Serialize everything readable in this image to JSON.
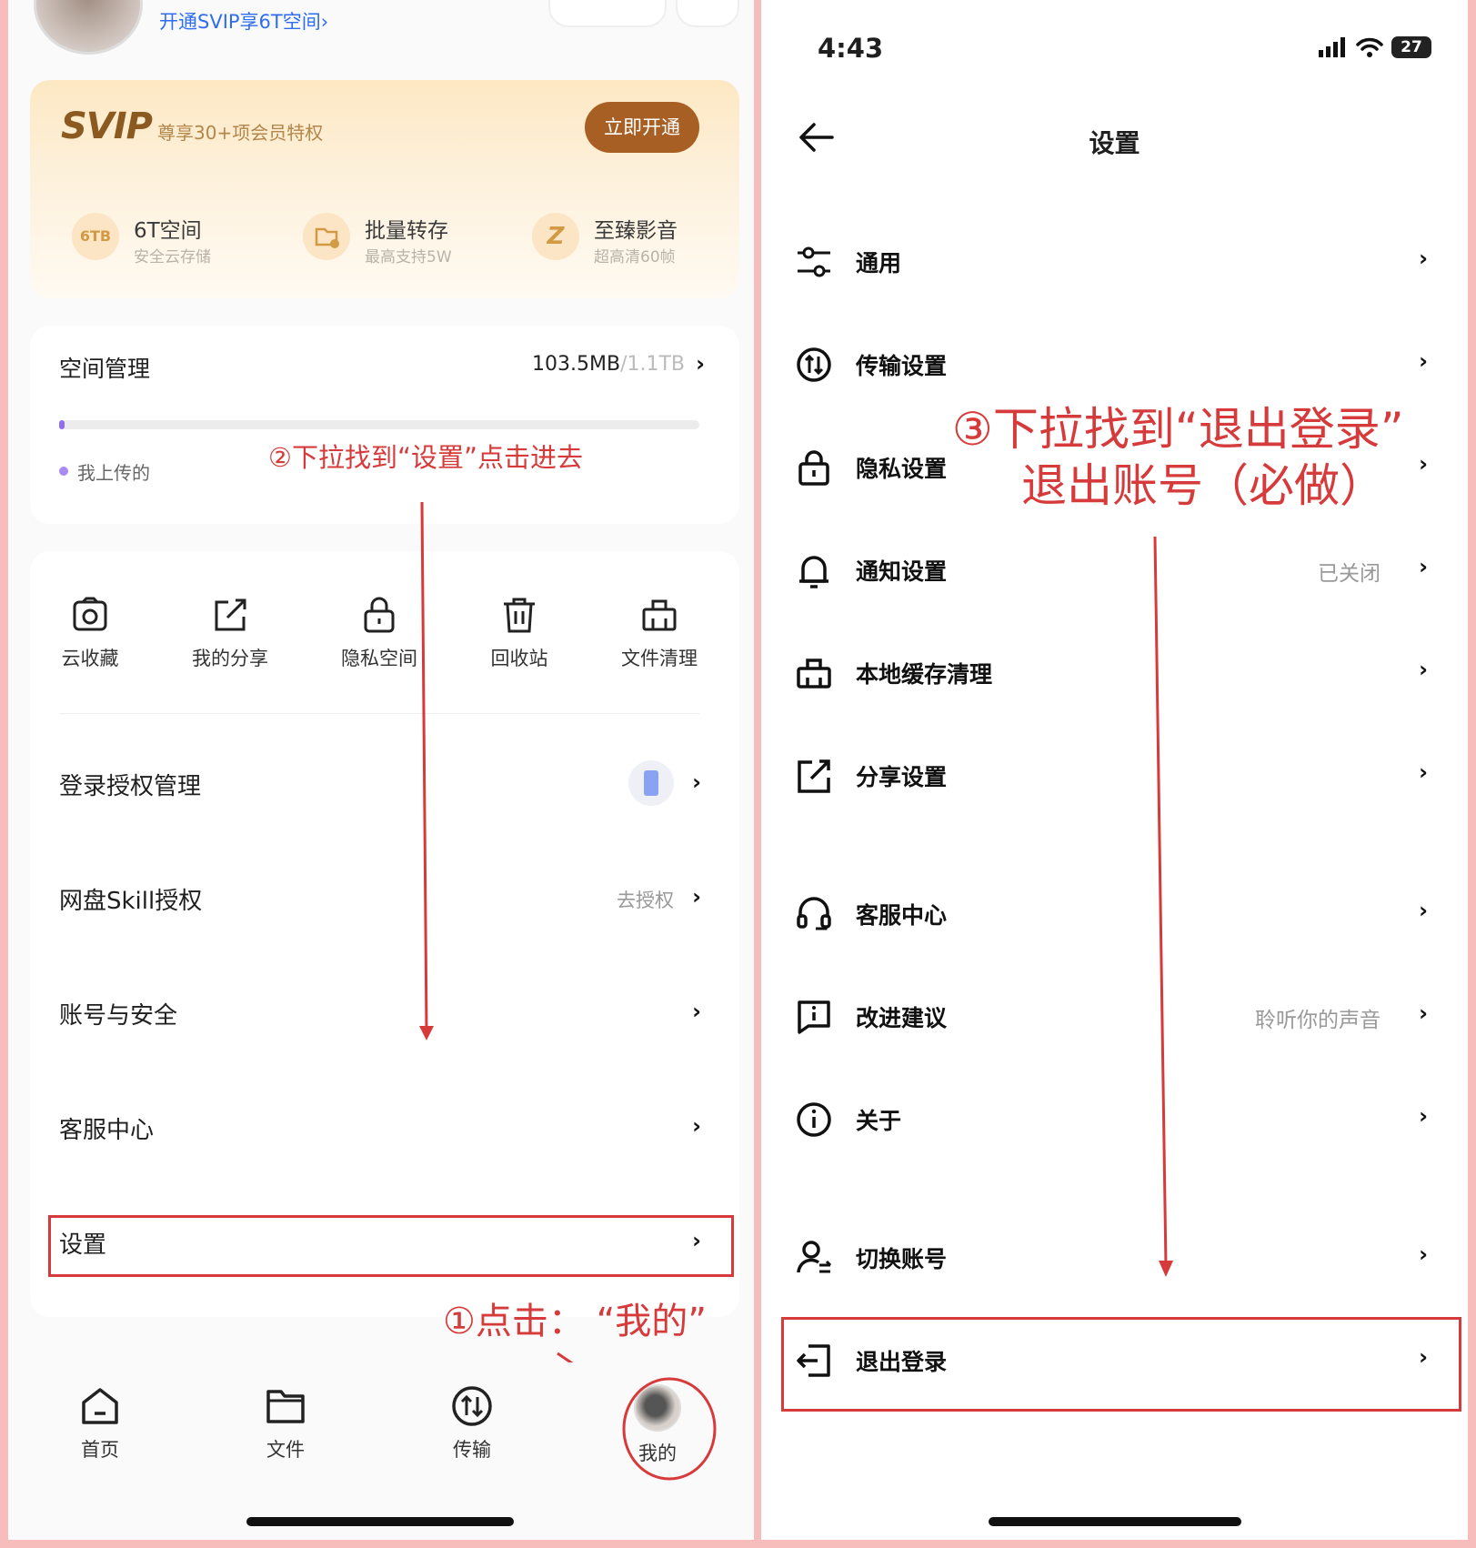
{
  "left": {
    "header_link": "开通SVIP享6T空间›",
    "svip": {
      "logo": "SVIP",
      "subtitle": "尊享30+项会员特权",
      "open_button": "立即开通",
      "perks": [
        {
          "icon_text": "6TB",
          "title": "6T空间",
          "subtitle": "安全云存储"
        },
        {
          "icon_text": "",
          "title": "批量转存",
          "subtitle": "最高支持5W"
        },
        {
          "icon_text": "Z",
          "title": "至臻影音",
          "subtitle": "超高清60帧"
        }
      ]
    },
    "space": {
      "title": "空间管理",
      "used": "103.5MB",
      "total": "/1.1TB",
      "chevron": "›",
      "progress_fraction": 0.009,
      "legend": "我上传的"
    },
    "annotation_2": "②下拉找到“设置”点击进去",
    "tools": [
      {
        "label": "云收藏",
        "icon": "cloud-collect-icon"
      },
      {
        "label": "我的分享",
        "icon": "share-icon"
      },
      {
        "label": "隐私空间",
        "icon": "lock-icon"
      },
      {
        "label": "回收站",
        "icon": "trash-icon"
      },
      {
        "label": "文件清理",
        "icon": "broom-icon"
      }
    ],
    "menu": [
      {
        "label": "登录授权管理",
        "value": ""
      },
      {
        "label": "网盘Skill授权",
        "value": "去授权"
      },
      {
        "label": "账号与安全",
        "value": ""
      },
      {
        "label": "客服中心",
        "value": ""
      },
      {
        "label": "设置",
        "value": ""
      }
    ],
    "annotation_1": "①点击：  “我的”",
    "tabs": [
      {
        "label": "首页",
        "icon": "home-icon"
      },
      {
        "label": "文件",
        "icon": "folder-icon"
      },
      {
        "label": "传输",
        "icon": "transfer-icon"
      },
      {
        "label": "我的",
        "icon": "avatar"
      }
    ]
  },
  "right": {
    "status": {
      "time": "4:43",
      "battery": "27"
    },
    "title": "设置",
    "annotation_3_line1": "③下拉找到“退出登录”",
    "annotation_3_line2": "退出账号（必做）",
    "items": [
      {
        "label": "通用",
        "value": "",
        "icon": "sliders-icon"
      },
      {
        "label": "传输设置",
        "value": "",
        "icon": "transfer-icon"
      },
      {
        "label": "隐私设置",
        "value": "",
        "icon": "lock-icon"
      },
      {
        "label": "通知设置",
        "value": "已关闭",
        "icon": "bell-icon"
      },
      {
        "label": "本地缓存清理",
        "value": "",
        "icon": "broom-icon"
      },
      {
        "label": "分享设置",
        "value": "",
        "icon": "share-icon"
      },
      {
        "label": "客服中心",
        "value": "",
        "icon": "headset-icon"
      },
      {
        "label": "改进建议",
        "value": "聆听你的声音",
        "icon": "feedback-icon"
      },
      {
        "label": "关于",
        "value": "",
        "icon": "info-icon"
      },
      {
        "label": "切换账号",
        "value": "",
        "icon": "switch-account-icon"
      },
      {
        "label": "退出登录",
        "value": "",
        "icon": "logout-icon"
      }
    ]
  },
  "colors": {
    "annotation": "#d63a3a",
    "svip_brown": "#a85f24",
    "link_blue": "#2f6cf0"
  }
}
